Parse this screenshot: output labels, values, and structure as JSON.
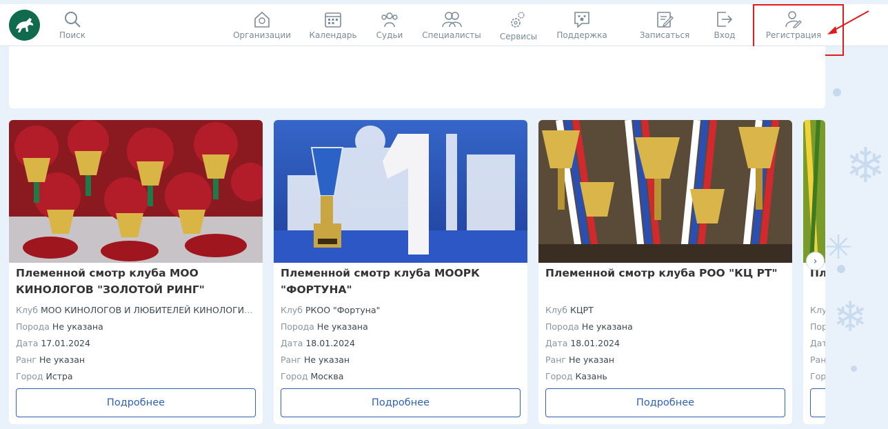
{
  "nav": {
    "search": "Поиск",
    "items": [
      {
        "label": "Организации",
        "icon": "organization-icon"
      },
      {
        "label": "Календарь",
        "icon": "calendar-icon"
      },
      {
        "label": "Судьи",
        "icon": "judges-icon"
      },
      {
        "label": "Специалисты",
        "icon": "specialists-icon"
      },
      {
        "label": "Сервисы",
        "icon": "services-icon"
      },
      {
        "label": "Поддержка",
        "icon": "support-icon"
      },
      {
        "label": "Записаться",
        "icon": "signup-icon"
      },
      {
        "label": "Вход",
        "icon": "login-icon"
      },
      {
        "label": "Регистрация",
        "icon": "registration-icon"
      }
    ]
  },
  "cards": [
    {
      "title": "Племенной смотр клуба МОО КИНОЛОГОВ \"ЗОЛОТОЙ РИНГ\"",
      "club_label": "Клуб",
      "club": "МОО КИНОЛОГОВ И ЛЮБИТЕЛЕЙ КИНОЛОГИИ ...",
      "breed_label": "Порода",
      "breed": "Не указана",
      "date_label": "Дата",
      "date": "17.01.2024",
      "rank_label": "Ранг",
      "rank": "Не указан",
      "city_label": "Город",
      "city": "Истра",
      "button": "Подробнее"
    },
    {
      "title": "Племенной смотр клуба МООРК \"ФОРТУНА\"",
      "club_label": "Клуб",
      "club": "РКОО \"Фортуна\"",
      "breed_label": "Порода",
      "breed": "Не указана",
      "date_label": "Дата",
      "date": "18.01.2024",
      "rank_label": "Ранг",
      "rank": "Не указан",
      "city_label": "Город",
      "city": "Москва",
      "button": "Подробнее"
    },
    {
      "title": "Племенной смотр клуба РОО \"КЦ РТ\"",
      "club_label": "Клуб",
      "club": "КЦРТ",
      "breed_label": "Порода",
      "breed": "Не указана",
      "date_label": "Дата",
      "date": "18.01.2024",
      "rank_label": "Ранг",
      "rank": "Не указан",
      "city_label": "Город",
      "city": "Казань",
      "button": "Подробнее"
    }
  ],
  "partial_card": {
    "title": "Пл",
    "l1": "Клу",
    "l2": "Пор",
    "l3": "Дат",
    "l4": "Ран",
    "l5": "Гор"
  },
  "next_icon": "›",
  "colors": {
    "accent": "#2e63b4",
    "logo": "#0f6b4c",
    "annotation": "#e3191b",
    "background": "#e9f1fb"
  }
}
